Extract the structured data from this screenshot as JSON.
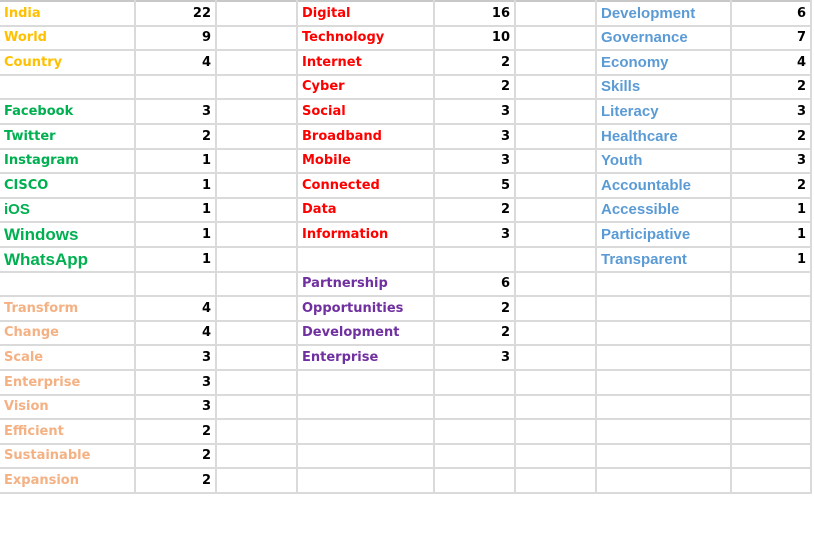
{
  "sheet": {
    "colors": {
      "gold": "#ffc000",
      "green": "#00b050",
      "red": "#ff0000",
      "purple": "#7030a0",
      "peach": "#f4b183",
      "blue": "#5b9bd5",
      "number": "#000000",
      "gridline": "#dadada"
    },
    "rows": [
      {
        "a": "India",
        "b": "22",
        "d": "Digital",
        "e": "16",
        "g": "Development",
        "h": "6"
      },
      {
        "a": "World",
        "b": "9",
        "d": "Technology",
        "e": "10",
        "g": "Governance",
        "h": "7"
      },
      {
        "a": "Country",
        "b": "4",
        "d": "Internet",
        "e": "2",
        "g": "Economy",
        "h": "4"
      },
      {
        "a": "",
        "b": "",
        "d": "Cyber",
        "e": "2",
        "g": "Skills",
        "h": "2"
      },
      {
        "a": "Facebook",
        "b": "3",
        "d": "Social",
        "e": "3",
        "g": "Literacy",
        "h": "3"
      },
      {
        "a": "Twitter",
        "b": "2",
        "d": "Broadband",
        "e": "3",
        "g": "Healthcare",
        "h": "2"
      },
      {
        "a": "Instagram",
        "b": "1",
        "d": "Mobile",
        "e": "3",
        "g": "Youth",
        "h": "3"
      },
      {
        "a": "CISCO",
        "b": "1",
        "d": "Connected",
        "e": "5",
        "g": "Accountable",
        "h": "2"
      },
      {
        "a": "iOS",
        "b": "1",
        "d": "Data",
        "e": "2",
        "g": "Accessible",
        "h": "1"
      },
      {
        "a": "Windows",
        "b": "1",
        "d": "Information",
        "e": "3",
        "g": "Participative",
        "h": "1"
      },
      {
        "a": "WhatsApp",
        "b": "1",
        "d": "",
        "e": "",
        "g": "Transparent",
        "h": "1"
      },
      {
        "a": "",
        "b": "",
        "d": "Partnership",
        "e": "6",
        "g": "",
        "h": ""
      },
      {
        "a": "Transform",
        "b": "4",
        "d": "Opportunities",
        "e": "2",
        "g": "",
        "h": ""
      },
      {
        "a": "Change",
        "b": "4",
        "d": "Development",
        "e": "2",
        "g": "",
        "h": ""
      },
      {
        "a": "Scale",
        "b": "3",
        "d": "Enterprise",
        "e": "3",
        "g": "",
        "h": ""
      },
      {
        "a": "Enterprise",
        "b": "3",
        "d": "",
        "e": "",
        "g": "",
        "h": ""
      },
      {
        "a": "Vision",
        "b": "3",
        "d": "",
        "e": "",
        "g": "",
        "h": ""
      },
      {
        "a": "Efficient",
        "b": "2",
        "d": "",
        "e": "",
        "g": "",
        "h": ""
      },
      {
        "a": "Sustainable",
        "b": "2",
        "d": "",
        "e": "",
        "g": "",
        "h": ""
      },
      {
        "a": "Expansion",
        "b": "2",
        "d": "",
        "e": "",
        "g": "",
        "h": ""
      }
    ]
  }
}
